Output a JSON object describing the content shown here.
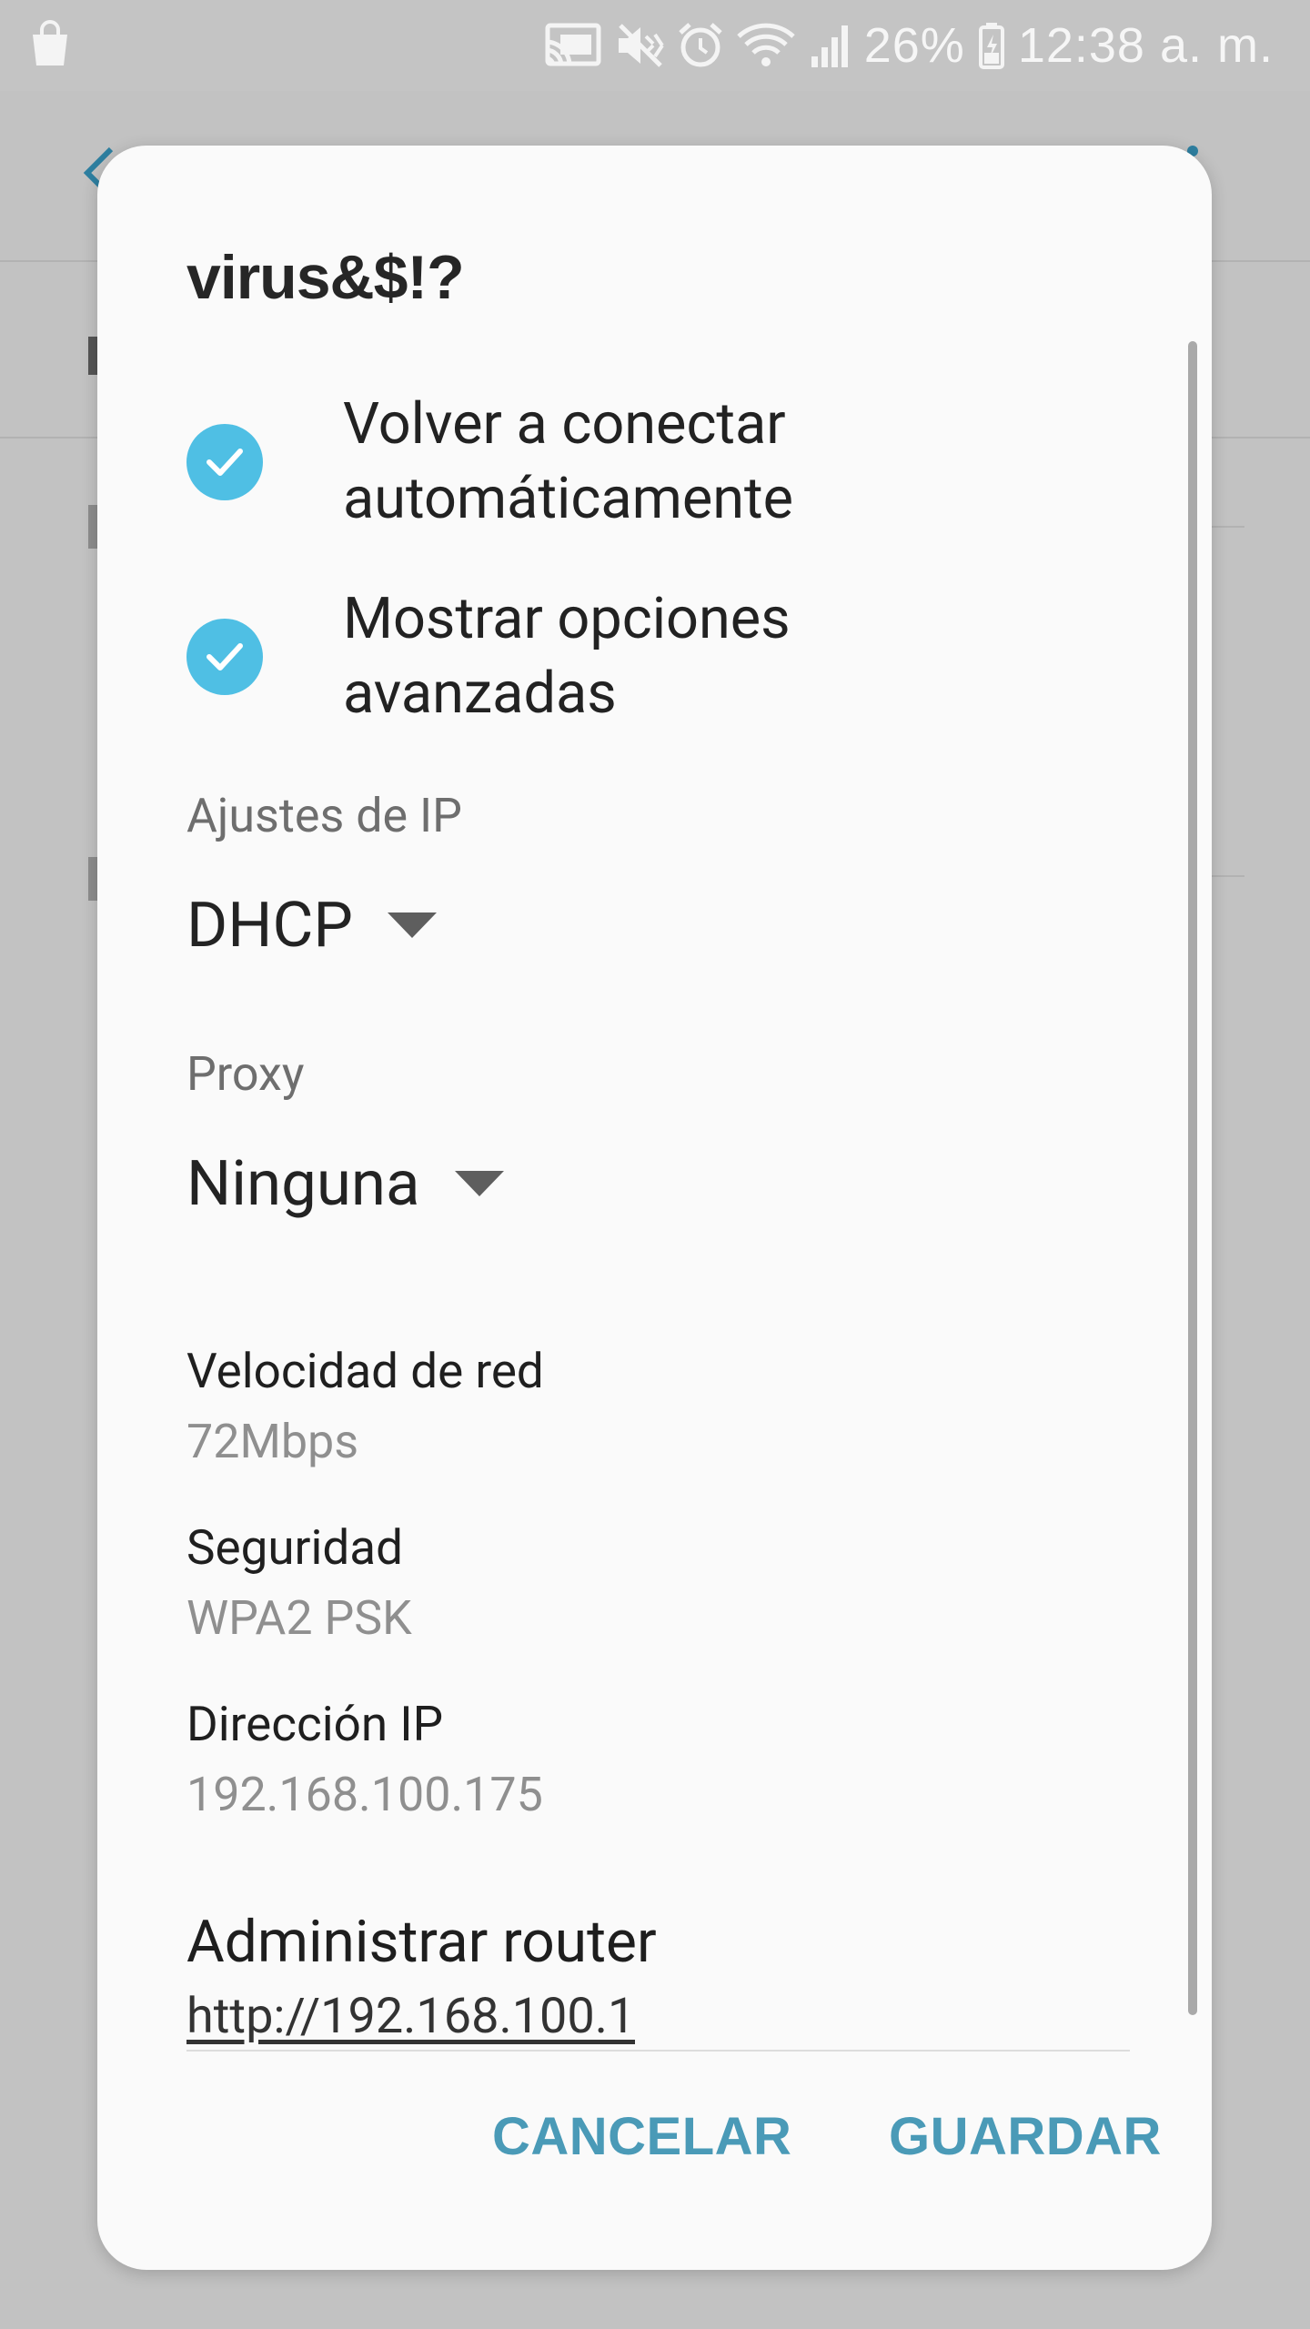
{
  "status_bar": {
    "battery_percent": "26%",
    "time": "12:38 a. m.",
    "left_icon": "shopping-bag-icon",
    "right_icons": [
      "cast-icon",
      "mute-icon",
      "alarm-icon",
      "wifi-icon",
      "signal-icon",
      "battery-icon"
    ]
  },
  "dialog": {
    "title": "virus&$!?",
    "checkboxes": [
      {
        "line1": "Volver a conectar",
        "line2": "automáticamente",
        "checked": true
      },
      {
        "line1": "Mostrar opciones",
        "line2": "avanzadas",
        "checked": true
      }
    ],
    "ip_settings": {
      "label": "Ajustes de IP",
      "value": "DHCP"
    },
    "proxy": {
      "label": "Proxy",
      "value": "Ninguna"
    },
    "info": [
      {
        "label": "Velocidad de red",
        "value": "72Mbps"
      },
      {
        "label": "Seguridad",
        "value": "WPA2 PSK"
      },
      {
        "label": "Dirección IP",
        "value": "192.168.100.175"
      }
    ],
    "router": {
      "title": "Administrar router",
      "link": "http://192.168.100.1"
    },
    "buttons": {
      "cancel": "CANCELAR",
      "save": "GUARDAR"
    }
  },
  "colors": {
    "accent": "#4a9ab7",
    "check": "#4fbfe4",
    "scrim": "#c2c2c2",
    "dialog_bg": "#fafafa"
  }
}
